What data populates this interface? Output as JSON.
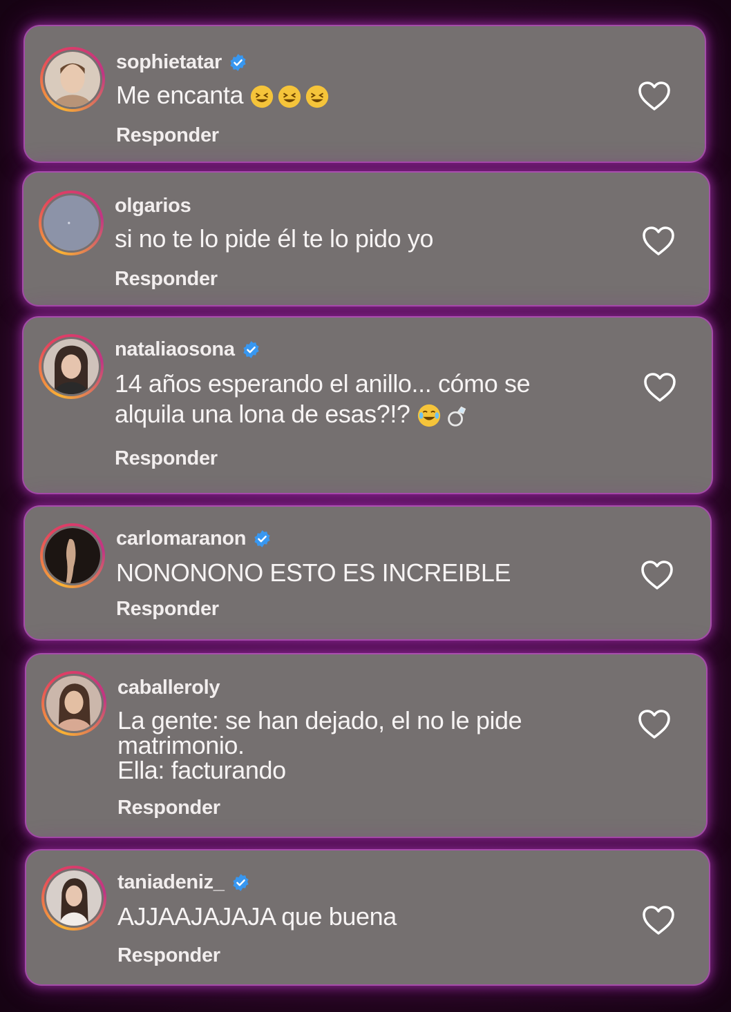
{
  "comments": [
    {
      "username": "sophietatar",
      "verified": true,
      "text": "Me encanta",
      "emojis": [
        "grinning-squint-face",
        "grinning-squint-face",
        "grinning-squint-face"
      ],
      "reply_label": "Responder"
    },
    {
      "username": "olgarios",
      "verified": false,
      "text": "si no te lo pide él te lo pido yo",
      "emojis": [],
      "reply_label": "Responder"
    },
    {
      "username": "nataliaosona",
      "verified": true,
      "text": "14 años esperando el anillo... cómo se\nalquila una lona de esas?!?",
      "emojis": [
        "tears-of-joy-face",
        "ring"
      ],
      "reply_label": "Responder"
    },
    {
      "username": "carlomaranon",
      "verified": true,
      "text": "NONONONO ESTO ES INCREIBLE",
      "emojis": [],
      "reply_label": "Responder"
    },
    {
      "username": "caballeroly",
      "verified": false,
      "text": "La gente: se han dejado, el no le pide\nmatrimonio.\nElla: facturando",
      "emojis": [],
      "reply_label": "Responder"
    },
    {
      "username": "taniadeniz_",
      "verified": true,
      "text": "AJJAAJAJAJA que buena",
      "emojis": [],
      "reply_label": "Responder"
    }
  ],
  "colors": {
    "card": "#757070",
    "verified": "#3897f0",
    "glow": "#c23cc8"
  },
  "icons": {
    "like": "heart-outline-icon",
    "verified": "verified-badge-icon"
  }
}
